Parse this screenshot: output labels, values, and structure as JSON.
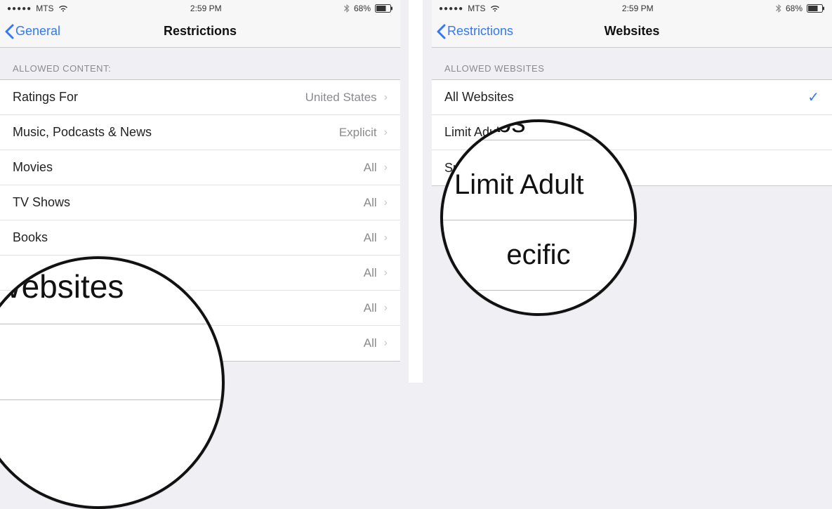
{
  "status": {
    "carrier": "MTS",
    "signal_dots": "●●●●●",
    "time": "2:59 PM",
    "battery_pct": "68%"
  },
  "left": {
    "back_label": "General",
    "title": "Restrictions",
    "section": "ALLOWED CONTENT:",
    "rows": [
      {
        "label": "Ratings For",
        "value": "United States"
      },
      {
        "label": "Music, Podcasts & News",
        "value": "Explicit"
      },
      {
        "label": "Movies",
        "value": "All"
      },
      {
        "label": "TV Shows",
        "value": "All"
      },
      {
        "label": "Books",
        "value": "All"
      },
      {
        "label": "",
        "value": "All"
      },
      {
        "label": "",
        "value": "All"
      },
      {
        "label": "",
        "value": "All"
      }
    ],
    "magnifier_text": "Websites"
  },
  "right": {
    "back_label": "Restrictions",
    "title": "Websites",
    "section": "ALLOWED WEBSITES",
    "rows": [
      {
        "label": "All Websites",
        "checked": true
      },
      {
        "label": "Limit Adult Content",
        "checked": false
      },
      {
        "label": "Specific Websites Only",
        "checked": false
      }
    ],
    "magnifier_top": "Webs",
    "magnifier_mid": "Limit Adult",
    "magnifier_bot": "ecific"
  }
}
